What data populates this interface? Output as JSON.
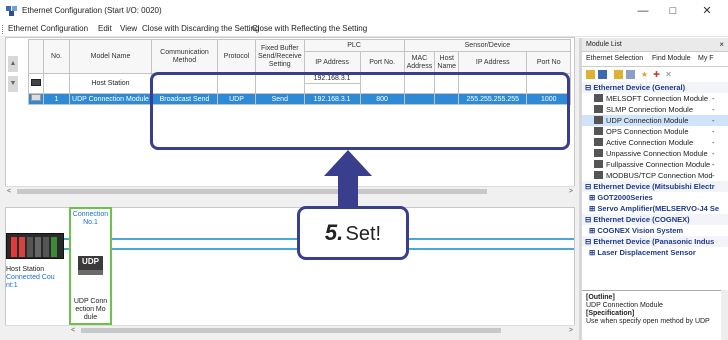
{
  "window": {
    "title": "Ethernet Configuration (Start I/O: 0020)",
    "minimize": "—",
    "maximize": "□",
    "close": "✕"
  },
  "menu": [
    "Ethernet Configuration",
    "Edit",
    "View",
    "Close with Discarding the Setting",
    "Close with Reflecting the Setting"
  ],
  "table": {
    "headers": {
      "no": "No.",
      "model": "Model Name",
      "comm": "Communication Method",
      "protocol": "Protocol",
      "fixed": "Fixed Buffer Send/Receive Setting",
      "plc": "PLC",
      "sensor": "Sensor/Device",
      "ip": "IP Address",
      "port": "Port No.",
      "mac": "MAC Address",
      "host": "Host Name",
      "sip": "IP Address",
      "sport": "Port No"
    },
    "host_row": {
      "model": "Host Station",
      "ip1": "192.168.3.1"
    },
    "selected_row": {
      "no": "1",
      "model": "UDP Connection Module",
      "comm": "Broadcast Send",
      "protocol": "UDP",
      "fixed": "Send",
      "ip": "192.168.3.1",
      "port": "800",
      "sip": "255.255.255.255",
      "sport": "1000"
    }
  },
  "diagram": {
    "host_label_line1": "Host Station",
    "host_label_line2": "Connected Cou",
    "host_label_line3": "nt:1",
    "conn_title": "Connection No.1",
    "udp_icon": "UDP",
    "conn_name": "UDP Conn ection Mo dule"
  },
  "callout": {
    "number": "5.",
    "text": "Set!"
  },
  "module_list": {
    "title": "Module List",
    "close": "×",
    "tabs": [
      "Ethernet Selection",
      "Find Module",
      "My F"
    ],
    "tree": [
      {
        "kind": "cat",
        "label": "⊟ Ethernet Device (General)"
      },
      {
        "kind": "item",
        "label": "MELSOFT Connection Module",
        "dash": "-"
      },
      {
        "kind": "item",
        "label": "SLMP Connection Module",
        "dash": "-"
      },
      {
        "kind": "item sel",
        "label": "UDP Connection Module",
        "dash": "-"
      },
      {
        "kind": "item",
        "label": "OPS Connection Module",
        "dash": "-"
      },
      {
        "kind": "item",
        "label": "Active Connection Module",
        "dash": "-"
      },
      {
        "kind": "item",
        "label": "Unpassive Connection Module",
        "dash": "-"
      },
      {
        "kind": "item",
        "label": "Fullpassive Connection Module",
        "dash": "-"
      },
      {
        "kind": "item",
        "label": "MODBUS/TCP Connection Mod",
        "dash": "-"
      },
      {
        "kind": "cat",
        "label": "⊟ Ethernet Device (Mitsubishi Electr"
      },
      {
        "kind": "sub",
        "label": "⊞ GOT2000Series"
      },
      {
        "kind": "sub",
        "label": "⊞ Servo Amplifier(MELSERVO-J4 Se"
      },
      {
        "kind": "cat",
        "label": "⊟ Ethernet Device (COGNEX)"
      },
      {
        "kind": "sub",
        "label": "⊞ COGNEX Vision System"
      },
      {
        "kind": "cat",
        "label": "⊟ Ethernet Device (Panasonic Indus"
      },
      {
        "kind": "sub",
        "label": "⊞ Laser Displacement Sensor"
      }
    ]
  },
  "outline": {
    "label": "[Outline]",
    "text": "UDP Connection Module",
    "spec_label": "[Specification]",
    "spec_text": "Use when specify open method by UDP"
  },
  "colors": {
    "selected_row": "#2f8ad6",
    "highlight_border": "#3a3f8d",
    "connection_border": "#6cc24a",
    "network_line": "#4aa8d8"
  }
}
